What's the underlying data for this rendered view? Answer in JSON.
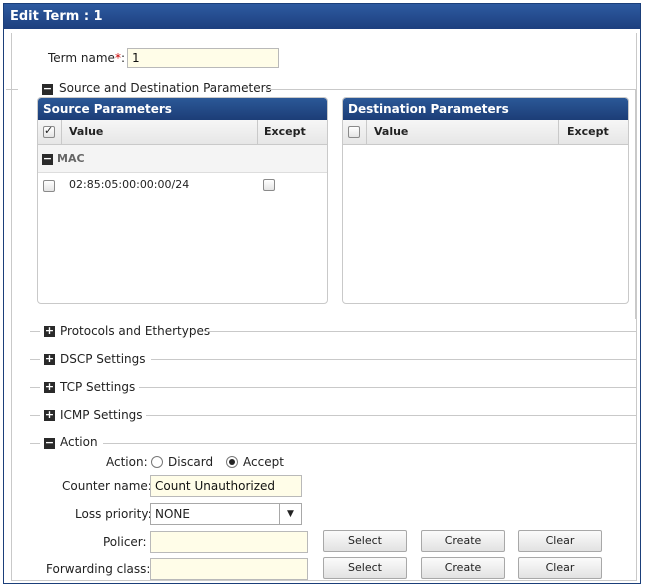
{
  "window": {
    "title": "Edit Term : 1"
  },
  "term": {
    "label": "Term name",
    "required_mark": "*",
    "colon": ":",
    "value": "1"
  },
  "source_dest": {
    "legend": "Source and Destination Parameters",
    "source": {
      "header": "Source Parameters",
      "col_value": "Value",
      "col_except": "Except",
      "group_label": "MAC",
      "rows": [
        {
          "value": "02:85:05:00:00:00/24",
          "checked": false,
          "except": false
        }
      ]
    },
    "destination": {
      "header": "Destination Parameters",
      "col_value": "Value",
      "col_except": "Except"
    }
  },
  "collapsed_sections": [
    {
      "label": "Protocols and Ethertypes"
    },
    {
      "label": "DSCP Settings"
    },
    {
      "label": "TCP Settings"
    },
    {
      "label": "ICMP Settings"
    }
  ],
  "action": {
    "legend": "Action",
    "action_label": "Action:",
    "discard_label": "Discard",
    "accept_label": "Accept",
    "selected": "Accept",
    "counter_label": "Counter name:",
    "counter_value": "Count Unauthorized",
    "loss_label": "Loss priority:",
    "loss_value": "NONE",
    "policer_label": "Policer:",
    "policer_value": "",
    "forwarding_label": "Forwarding class:",
    "forwarding_value": "",
    "select_label": "Select",
    "create_label": "Create",
    "clear_label": "Clear"
  }
}
